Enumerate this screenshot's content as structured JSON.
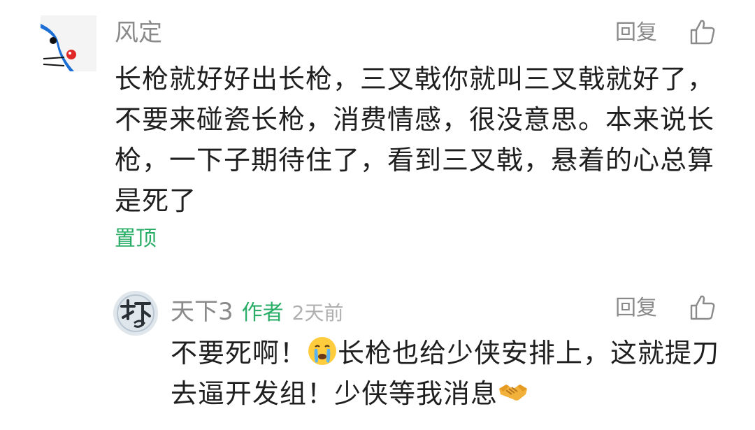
{
  "comment": {
    "author": "风定",
    "reply_label": "回复",
    "text": "长枪就好好出长枪，三叉戟你就叫三叉戟就好了，不要来碰瓷长枪，消费情感，很没意思。本来说长枪，一下子期待住了，看到三叉戟，悬着的心总算是死了",
    "pinned_label": "置顶"
  },
  "reply": {
    "author": "天下3",
    "author_badge": "作者",
    "time": "2天前",
    "reply_label": "回复",
    "text_part1": "不要死啊！",
    "text_part2": "长枪也给少侠安排上，这就提刀去逼开发组！少侠等我消息",
    "emoji_1": "crying-face-icon",
    "emoji_2": "handshake-icon"
  },
  "colors": {
    "accent_green": "#2aae67",
    "meta_gray": "#8a8a8a",
    "body_text": "#1f1f1f"
  }
}
